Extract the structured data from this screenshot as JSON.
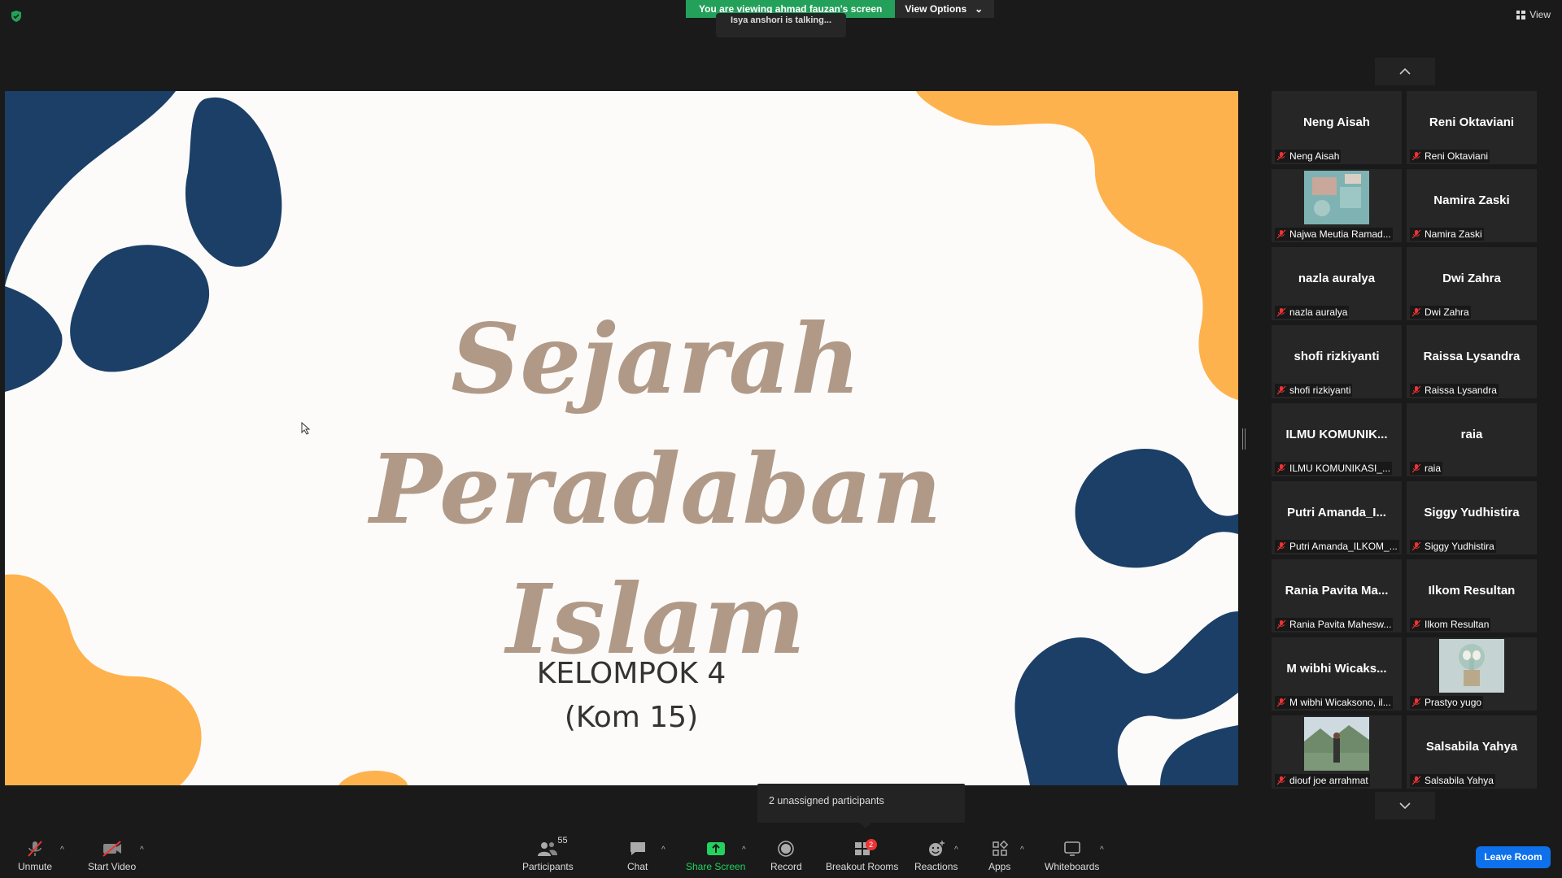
{
  "banner": {
    "viewing_text": "You are viewing ahmad fauzan's screen",
    "view_options": "View Options"
  },
  "talking": "Isya anshori is talking...",
  "view_label": "View",
  "slide": {
    "title_line1": "Sejarah Peradaban",
    "title_line2": "Islam",
    "subtitle_line1": "KELOMPOK 4",
    "subtitle_line2": "(Kom 15)"
  },
  "gallery": [
    {
      "display": "Neng Aisah",
      "label": "Neng Aisah"
    },
    {
      "display": "Reni Oktaviani",
      "label": "Reni Oktaviani"
    },
    {
      "display": "",
      "label": "Najwa Meutia Ramad...",
      "thumb": "teal-pattern"
    },
    {
      "display": "Namira Zaski",
      "label": "Namira Zaski"
    },
    {
      "display": "nazla auralya",
      "label": "nazla auralya"
    },
    {
      "display": "Dwi Zahra",
      "label": "Dwi Zahra"
    },
    {
      "display": "shofi rizkiyanti",
      "label": "shofi rizkiyanti"
    },
    {
      "display": "Raissa Lysandra",
      "label": "Raissa Lysandra"
    },
    {
      "display": "ILMU  KOMUNIK...",
      "label": "ILMU KOMUNIKASI_..."
    },
    {
      "display": "raia",
      "label": "raia"
    },
    {
      "display": "Putri  Amanda_I...",
      "label": "Putri Amanda_ILKOM_..."
    },
    {
      "display": "Siggy Yudhistira",
      "label": "Siggy Yudhistira"
    },
    {
      "display": "Rania  Pavita  Ma...",
      "label": "Rania Pavita Mahesw..."
    },
    {
      "display": "Ilkom Resultan",
      "label": "Ilkom Resultan"
    },
    {
      "display": "M  wibhi  Wicaks...",
      "label": "M wibhi Wicaksono, il..."
    },
    {
      "display": "",
      "label": "Prastyo yugo",
      "thumb": "cartoon"
    },
    {
      "display": "",
      "label": "diouf joe arrahmat",
      "thumb": "outdoor-photo"
    },
    {
      "display": "Salsabila Yahya",
      "label": "Salsabila Yahya"
    }
  ],
  "unassigned_text": "2 unassigned participants",
  "toolbar": {
    "unmute": "Unmute",
    "start_video": "Start Video",
    "participants": "Participants",
    "participants_count": "55",
    "chat": "Chat",
    "share_screen": "Share Screen",
    "record": "Record",
    "breakout_rooms": "Breakout Rooms",
    "breakout_badge": "2",
    "reactions": "Reactions",
    "apps": "Apps",
    "whiteboards": "Whiteboards",
    "leave_room": "Leave Room"
  },
  "colors": {
    "navy": "#1b3f66",
    "orange": "#feb24d",
    "title": "#b09a87",
    "share_green": "#23d160",
    "leave_blue": "#0e71eb"
  }
}
